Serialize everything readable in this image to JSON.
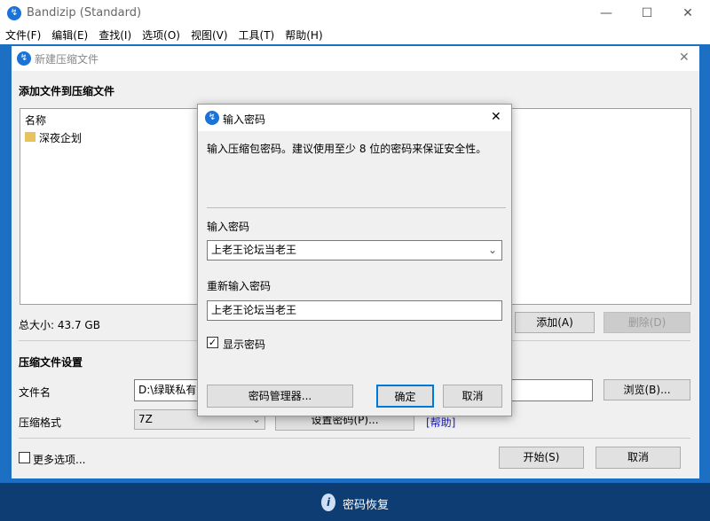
{
  "app": {
    "title": "Bandizip (Standard)",
    "controls": [
      "—",
      "☐",
      "✕"
    ]
  },
  "menu": [
    "文件(F)",
    "编辑(E)",
    "查找(I)",
    "选项(O)",
    "视图(V)",
    "工具(T)",
    "帮助(H)"
  ],
  "newArchive": {
    "title": "新建压缩文件",
    "add_section": "添加文件到压缩文件",
    "col_name": "名称",
    "files": [
      "深夜企划"
    ],
    "total_size": "总大小: 43.7 GB",
    "add_btn": "添加(A)",
    "delete_btn": "删除(D)",
    "settings_section": "压缩文件设置",
    "filename_label": "文件名",
    "filename_value": "D:\\绿联私有云",
    "browse_btn": "浏览(B)...",
    "format_label": "压缩格式",
    "format_value": "7Z",
    "set_password_btn": "设置密码(P)...",
    "help_link": "[帮助]",
    "more_options": "更多选项...",
    "start_btn": "开始(S)",
    "cancel_btn": "取消"
  },
  "passwordDialog": {
    "title": "输入密码",
    "hint": "输入压缩包密码。建议使用至少 8 位的密码来保证安全性。",
    "pw_label": "输入密码",
    "pw_value": "上老王论坛当老王",
    "repw_label": "重新输入密码",
    "repw_value": "上老王论坛当老王",
    "show_pw": "显示密码",
    "show_pw_checked": true,
    "manager_btn": "密码管理器...",
    "ok_btn": "确定",
    "cancel_btn": "取消"
  },
  "footer": {
    "label": "密码恢复"
  },
  "colors": {
    "accent": "#1a73d9",
    "footer": "#0d3d72",
    "link": "#2020c0"
  }
}
